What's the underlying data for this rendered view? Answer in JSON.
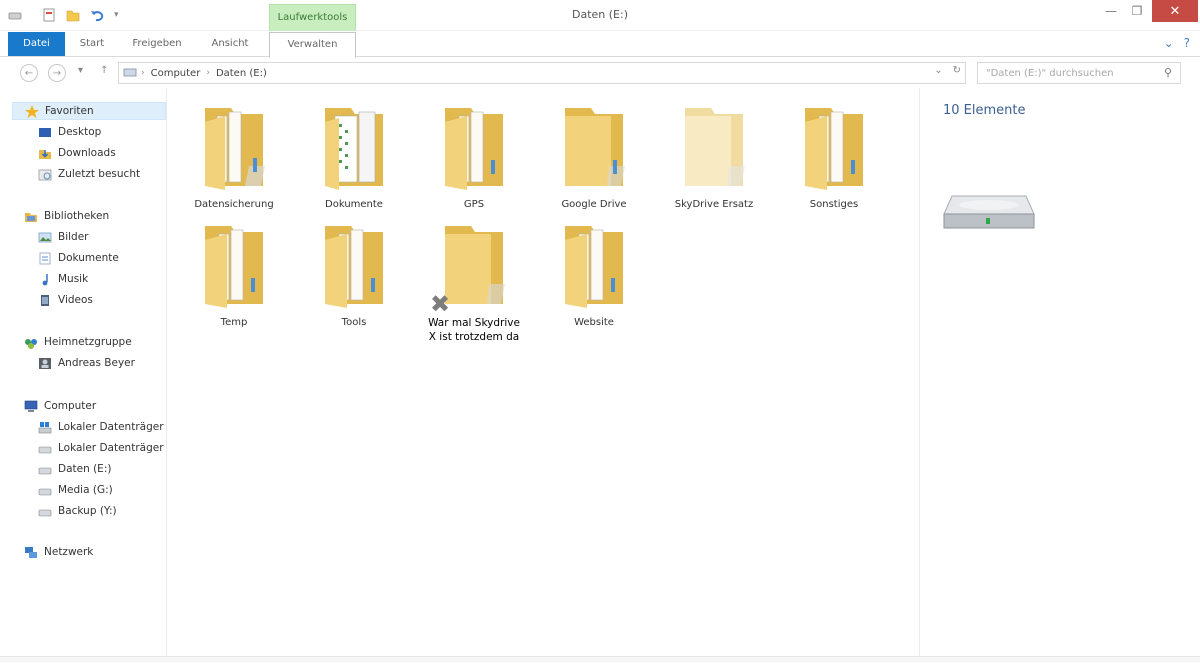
{
  "window": {
    "title": "Daten (E:)",
    "context_tab_header": "Laufwerktools"
  },
  "ribbon": {
    "tabs": [
      "Datei",
      "Start",
      "Freigeben",
      "Ansicht"
    ],
    "context_tab": "Verwalten"
  },
  "address": {
    "segments": [
      "Computer",
      "Daten (E:)"
    ],
    "search_placeholder": "\"Daten (E:)\" durchsuchen"
  },
  "nav": {
    "favorites": {
      "label": "Favoriten",
      "items": [
        "Desktop",
        "Downloads",
        "Zuletzt besucht"
      ]
    },
    "libraries": {
      "label": "Bibliotheken",
      "items": [
        "Bilder",
        "Dokumente",
        "Musik",
        "Videos"
      ]
    },
    "homegroup": {
      "label": "Heimnetzgruppe",
      "items": [
        "Andreas Beyer"
      ]
    },
    "computer": {
      "label": "Computer",
      "items": [
        "Lokaler Datenträger",
        "Lokaler Datenträger",
        "Daten (E:)",
        "Media (G:)",
        "Backup (Y:)"
      ]
    },
    "network": {
      "label": "Netzwerk"
    }
  },
  "folders": [
    "Datensicherung",
    "Dokumente",
    "GPS",
    "Google Drive",
    "SkyDrive Ersatz",
    "Sonstiges",
    "Temp",
    "Tools",
    "War mal Skydrive\nX ist trotzdem da",
    "Website"
  ],
  "details": {
    "count": "10 Elemente"
  },
  "colors": {
    "file_tab": "#1979ca",
    "close_button": "#c74b45",
    "context_tab": "#c8eec0",
    "folder_front": "#f2d27a",
    "folder_back": "#e2b94f"
  }
}
